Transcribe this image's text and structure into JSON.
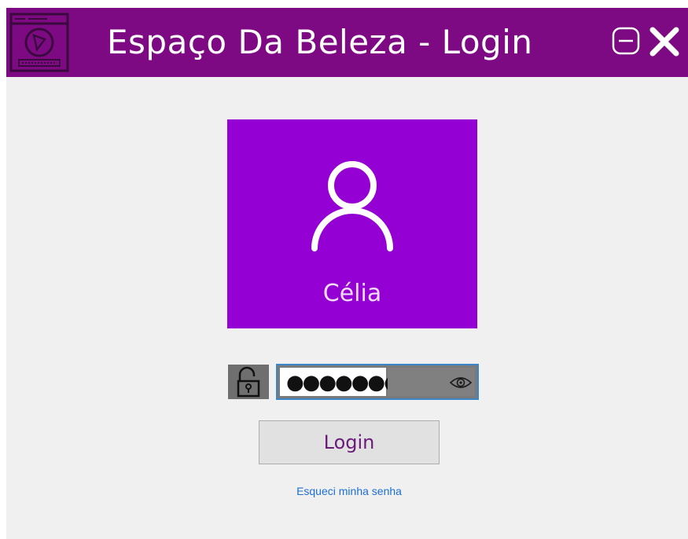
{
  "window": {
    "title": "Espaço Da Beleza - Login",
    "app_icon": "app-window-icon",
    "controls": {
      "minimize_icon": "minimize-icon",
      "close_icon": "close-icon"
    }
  },
  "user": {
    "icon": "user-avatar-icon",
    "name": "Célia"
  },
  "password": {
    "lock_icon": "unlocked-padlock-icon",
    "masked_value": "●●●●●●●●",
    "toggle_icon": "eye-icon"
  },
  "actions": {
    "login_label": "Login",
    "forgot_label": "Esqueci minha senha"
  },
  "colors": {
    "titlebar": "#7d0a82",
    "tile": "#9400d3",
    "link": "#1c6fd1",
    "field_border": "#3a86c8"
  }
}
